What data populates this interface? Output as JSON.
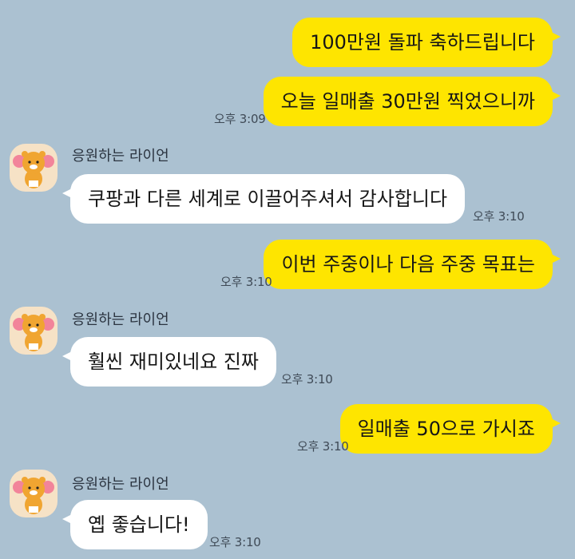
{
  "colors": {
    "background": "#abc1d1",
    "my_bubble": "#fee500",
    "other_bubble": "#ffffff",
    "avatar_bg": "#f6e2c6"
  },
  "messages": [
    {
      "from": "me",
      "text": "100만원 돌파 축하드립니다"
    },
    {
      "from": "me",
      "text": "오늘 일매출 30만원 찍었으니까",
      "time": "오후 3:09"
    },
    {
      "sender": "응원하는 라이언",
      "avatar_icon": "ryan-cheering-icon",
      "text": "쿠팡과 다른 세계로 이끌어주셔서 감사합니다",
      "time": "오후 3:10"
    },
    {
      "from": "me",
      "text": "이번 주중이나 다음 주중 목표는",
      "time": "오후 3:10"
    },
    {
      "sender": "응원하는 라이언",
      "avatar_icon": "ryan-cheering-icon",
      "text": "훨씬 재미있네요 진짜",
      "time": "오후 3:10"
    },
    {
      "from": "me",
      "text": "일매출 50으로 가시죠",
      "time": "오후 3:10"
    },
    {
      "sender": "응원하는 라이언",
      "avatar_icon": "ryan-cheering-icon",
      "text": "옙 좋습니다!",
      "time": "오후 3:10"
    }
  ]
}
